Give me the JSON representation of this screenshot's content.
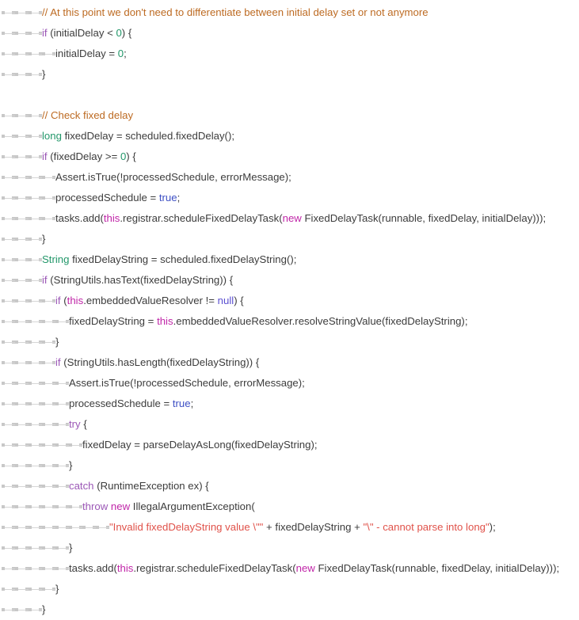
{
  "editor": {
    "language": "java",
    "background_color": "#ffffff",
    "default_text_color": "#3c3c3c",
    "show_whitespace_markers": true,
    "tab_marker_name": "tab-arrow",
    "colors": {
      "comment": "#bd6b23",
      "keyword": "#9b57b6",
      "type": "#23976a",
      "this_new": "#c026a8",
      "number": "#23976a",
      "boolean": "#3d4fc4",
      "null": "#5b4fd0",
      "string": "#e0524a",
      "plain": "#3c3c3c",
      "tab_marker": "#c8c8c8"
    }
  },
  "code": {
    "lines": [
      {
        "indent": 3,
        "tokens": [
          {
            "t": "// At this point we don't need to differentiate between initial delay set or not anymore",
            "c": "comment"
          }
        ]
      },
      {
        "indent": 3,
        "tokens": [
          {
            "t": "if",
            "c": "keyword"
          },
          {
            "t": " (initialDelay < ",
            "c": "plain"
          },
          {
            "t": "0",
            "c": "num"
          },
          {
            "t": ") {",
            "c": "plain"
          }
        ]
      },
      {
        "indent": 4,
        "tokens": [
          {
            "t": "initialDelay = ",
            "c": "plain"
          },
          {
            "t": "0",
            "c": "num"
          },
          {
            "t": ";",
            "c": "plain"
          }
        ]
      },
      {
        "indent": 3,
        "tokens": [
          {
            "t": "}",
            "c": "plain"
          }
        ]
      },
      {
        "indent": 0,
        "tokens": []
      },
      {
        "indent": 3,
        "tokens": [
          {
            "t": "// Check fixed delay",
            "c": "comment"
          }
        ]
      },
      {
        "indent": 3,
        "tokens": [
          {
            "t": "long",
            "c": "type"
          },
          {
            "t": " fixedDelay = scheduled.fixedDelay();",
            "c": "plain"
          }
        ]
      },
      {
        "indent": 3,
        "tokens": [
          {
            "t": "if",
            "c": "keyword"
          },
          {
            "t": " (fixedDelay >= ",
            "c": "plain"
          },
          {
            "t": "0",
            "c": "num"
          },
          {
            "t": ") {",
            "c": "plain"
          }
        ]
      },
      {
        "indent": 4,
        "tokens": [
          {
            "t": "Assert.isTrue(!processedSchedule, errorMessage);",
            "c": "plain"
          }
        ]
      },
      {
        "indent": 4,
        "tokens": [
          {
            "t": "processedSchedule = ",
            "c": "plain"
          },
          {
            "t": "true",
            "c": "bool"
          },
          {
            "t": ";",
            "c": "plain"
          }
        ]
      },
      {
        "indent": 4,
        "tokens": [
          {
            "t": "tasks.add(",
            "c": "plain"
          },
          {
            "t": "this",
            "c": "this"
          },
          {
            "t": ".registrar.scheduleFixedDelayTask(",
            "c": "plain"
          },
          {
            "t": "new",
            "c": "this"
          },
          {
            "t": " FixedDelayTask(runnable, fixedDelay, initialDelay)));",
            "c": "plain"
          }
        ]
      },
      {
        "indent": 3,
        "tokens": [
          {
            "t": "}",
            "c": "plain"
          }
        ]
      },
      {
        "indent": 3,
        "tokens": [
          {
            "t": "String",
            "c": "type"
          },
          {
            "t": " fixedDelayString = scheduled.fixedDelayString();",
            "c": "plain"
          }
        ]
      },
      {
        "indent": 3,
        "tokens": [
          {
            "t": "if",
            "c": "keyword"
          },
          {
            "t": " (StringUtils.hasText(fixedDelayString)) {",
            "c": "plain"
          }
        ]
      },
      {
        "indent": 4,
        "tokens": [
          {
            "t": "if",
            "c": "keyword"
          },
          {
            "t": " (",
            "c": "plain"
          },
          {
            "t": "this",
            "c": "this"
          },
          {
            "t": ".embeddedValueResolver != ",
            "c": "plain"
          },
          {
            "t": "null",
            "c": "null"
          },
          {
            "t": ") {",
            "c": "plain"
          }
        ]
      },
      {
        "indent": 5,
        "tokens": [
          {
            "t": "fixedDelayString = ",
            "c": "plain"
          },
          {
            "t": "this",
            "c": "this"
          },
          {
            "t": ".embeddedValueResolver.resolveStringValue(fixedDelayString);",
            "c": "plain"
          }
        ]
      },
      {
        "indent": 4,
        "tokens": [
          {
            "t": "}",
            "c": "plain"
          }
        ]
      },
      {
        "indent": 4,
        "tokens": [
          {
            "t": "if",
            "c": "keyword"
          },
          {
            "t": " (StringUtils.hasLength(fixedDelayString)) {",
            "c": "plain"
          }
        ]
      },
      {
        "indent": 5,
        "tokens": [
          {
            "t": "Assert.isTrue(!processedSchedule, errorMessage);",
            "c": "plain"
          }
        ]
      },
      {
        "indent": 5,
        "tokens": [
          {
            "t": "processedSchedule = ",
            "c": "plain"
          },
          {
            "t": "true",
            "c": "bool"
          },
          {
            "t": ";",
            "c": "plain"
          }
        ]
      },
      {
        "indent": 5,
        "tokens": [
          {
            "t": "try",
            "c": "keyword"
          },
          {
            "t": " {",
            "c": "plain"
          }
        ]
      },
      {
        "indent": 6,
        "tokens": [
          {
            "t": "fixedDelay = parseDelayAsLong(fixedDelayString);",
            "c": "plain"
          }
        ]
      },
      {
        "indent": 5,
        "tokens": [
          {
            "t": "}",
            "c": "plain"
          }
        ]
      },
      {
        "indent": 5,
        "tokens": [
          {
            "t": "catch",
            "c": "keyword"
          },
          {
            "t": " (RuntimeException ex) {",
            "c": "plain"
          }
        ]
      },
      {
        "indent": 6,
        "tokens": [
          {
            "t": "throw",
            "c": "keyword"
          },
          {
            "t": " ",
            "c": "plain"
          },
          {
            "t": "new",
            "c": "this"
          },
          {
            "t": " IllegalArgumentException(",
            "c": "plain"
          }
        ]
      },
      {
        "indent": 8,
        "tokens": [
          {
            "t": "\"Invalid fixedDelayString value \\\"\"",
            "c": "string"
          },
          {
            "t": " + fixedDelayString + ",
            "c": "plain"
          },
          {
            "t": "\"\\\" - cannot parse into long\"",
            "c": "string"
          },
          {
            "t": ");",
            "c": "plain"
          }
        ]
      },
      {
        "indent": 5,
        "tokens": [
          {
            "t": "}",
            "c": "plain"
          }
        ]
      },
      {
        "indent": 5,
        "tokens": [
          {
            "t": "tasks.add(",
            "c": "plain"
          },
          {
            "t": "this",
            "c": "this"
          },
          {
            "t": ".registrar.scheduleFixedDelayTask(",
            "c": "plain"
          },
          {
            "t": "new",
            "c": "this"
          },
          {
            "t": " FixedDelayTask(runnable, fixedDelay, initialDelay)));",
            "c": "plain"
          }
        ]
      },
      {
        "indent": 4,
        "tokens": [
          {
            "t": "}",
            "c": "plain"
          }
        ]
      },
      {
        "indent": 3,
        "tokens": [
          {
            "t": "}",
            "c": "plain"
          }
        ]
      }
    ]
  }
}
